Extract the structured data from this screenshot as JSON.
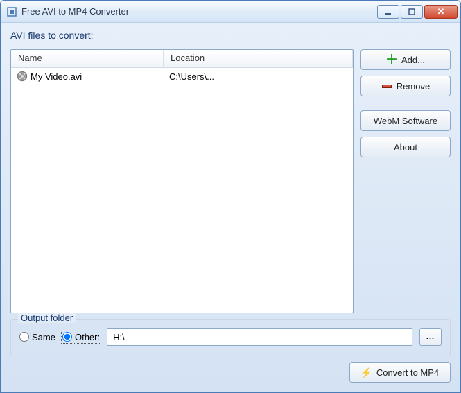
{
  "window": {
    "title": "Free AVI to MP4 Converter"
  },
  "list": {
    "label": "AVI files to convert:",
    "cols": {
      "name": "Name",
      "location": "Location"
    },
    "rows": [
      {
        "name": "My Video.avi",
        "location": "C:\\Users\\..."
      }
    ]
  },
  "buttons": {
    "add": "Add...",
    "remove": "Remove",
    "webm": "WebM Software",
    "about": "About",
    "browse": "...",
    "convert": "Convert to MP4"
  },
  "output": {
    "legend": "Output folder",
    "same": "Same",
    "other": "Other:",
    "selected": "other",
    "path": "H:\\"
  }
}
